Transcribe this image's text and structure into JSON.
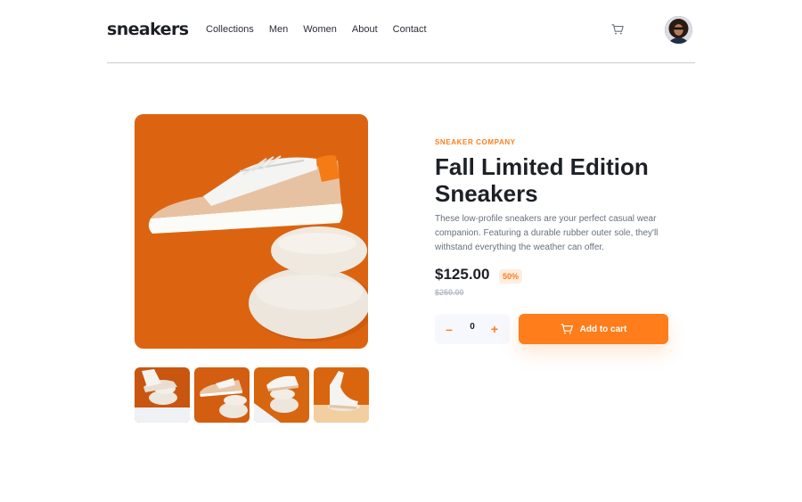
{
  "header": {
    "logo": "sneakers",
    "nav": [
      "Collections",
      "Men",
      "Women",
      "About",
      "Contact"
    ],
    "cart_icon": "cart-icon",
    "avatar_icon": "user-avatar"
  },
  "gallery": {
    "thumbnail_count": 4
  },
  "product": {
    "company": "SNEAKER COMPANY",
    "title": "Fall Limited Edition Sneakers",
    "description": "These low-profile sneakers are your perfect casual wear companion. Featuring a durable rubber outer sole, they'll withstand everything the weather can offer.",
    "price": "$125.00",
    "discount": "50%",
    "original_price": "$250.00"
  },
  "cart": {
    "minus": "–",
    "quantity": "0",
    "plus": "+",
    "add_label": "Add to cart"
  },
  "colors": {
    "accent": "#ff7d1a",
    "accent_pale": "#ffede0",
    "text_dark": "#1d2026",
    "text_gray": "#68707d"
  }
}
